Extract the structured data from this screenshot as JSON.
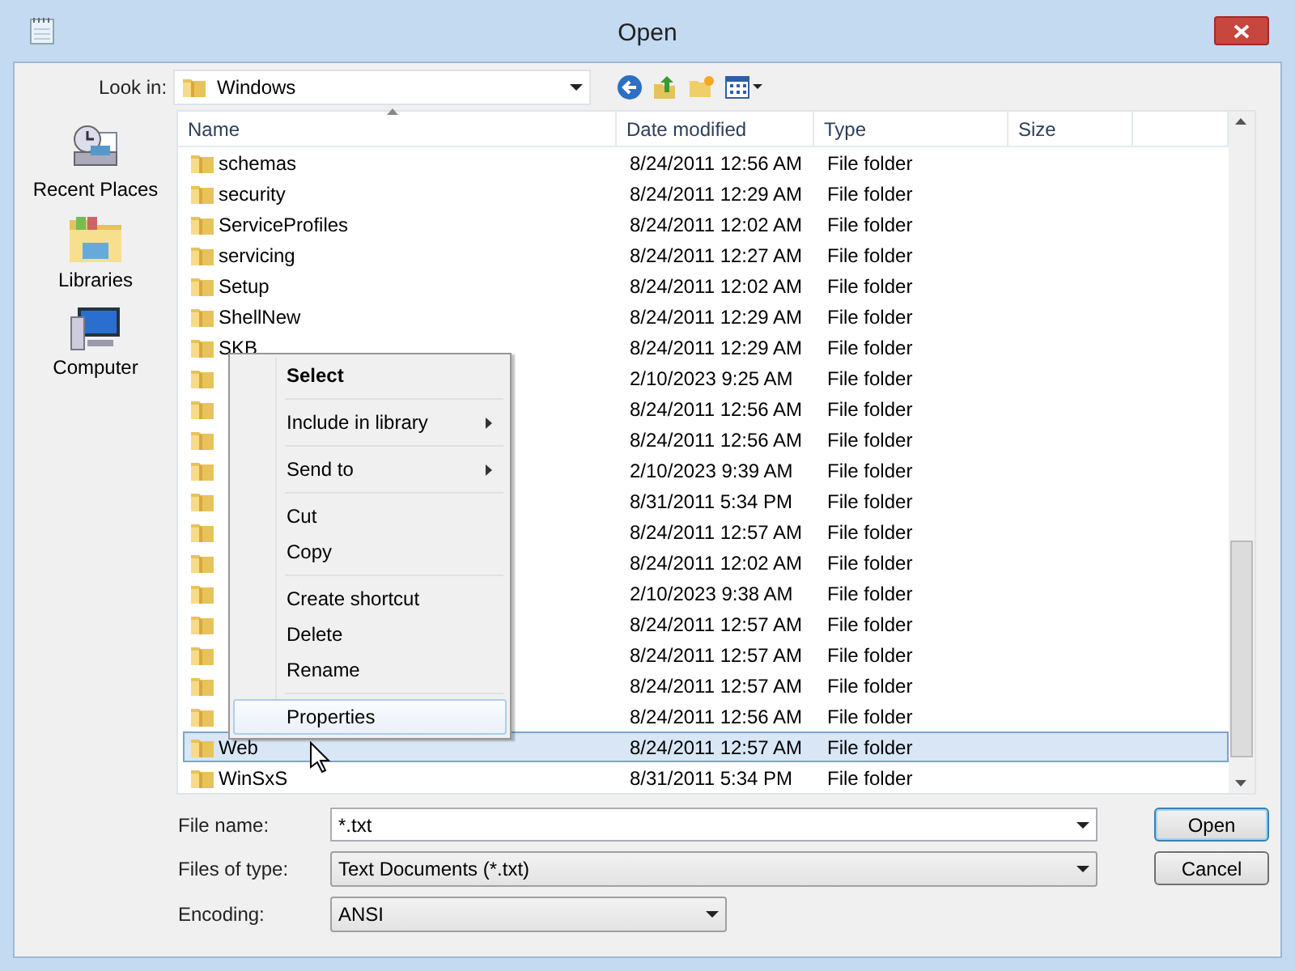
{
  "window": {
    "title": "Open"
  },
  "look_in": {
    "label": "Look in:",
    "value": "Windows"
  },
  "places": [
    {
      "label": "Recent Places",
      "kind": "recent"
    },
    {
      "label": "Libraries",
      "kind": "libraries"
    },
    {
      "label": "Computer",
      "kind": "computer"
    }
  ],
  "table": {
    "columns": [
      "Name",
      "Date modified",
      "Type",
      "Size"
    ],
    "rows": [
      {
        "name": "schemas",
        "date": "8/24/2011 12:56 AM",
        "type": "File folder",
        "selected": false
      },
      {
        "name": "security",
        "date": "8/24/2011 12:29 AM",
        "type": "File folder",
        "selected": false
      },
      {
        "name": "ServiceProfiles",
        "date": "8/24/2011 12:02 AM",
        "type": "File folder",
        "selected": false
      },
      {
        "name": "servicing",
        "date": "8/24/2011 12:27 AM",
        "type": "File folder",
        "selected": false
      },
      {
        "name": "Setup",
        "date": "8/24/2011 12:02 AM",
        "type": "File folder",
        "selected": false
      },
      {
        "name": "ShellNew",
        "date": "8/24/2011 12:29 AM",
        "type": "File folder",
        "selected": false
      },
      {
        "name": "SKB",
        "date": "8/24/2011 12:29 AM",
        "type": "File folder",
        "selected": false
      },
      {
        "date": "2/10/2023 9:25 AM",
        "type": "File folder",
        "selected": false
      },
      {
        "date": "8/24/2011 12:56 AM",
        "type": "File folder",
        "selected": false
      },
      {
        "date": "8/24/2011 12:56 AM",
        "type": "File folder",
        "selected": false
      },
      {
        "date": "2/10/2023 9:39 AM",
        "type": "File folder",
        "selected": false
      },
      {
        "date": "8/31/2011 5:34 PM",
        "type": "File folder",
        "selected": false
      },
      {
        "date": "8/24/2011 12:57 AM",
        "type": "File folder",
        "selected": false
      },
      {
        "date": "8/24/2011 12:02 AM",
        "type": "File folder",
        "selected": false
      },
      {
        "date": "2/10/2023 9:38 AM",
        "type": "File folder",
        "selected": false
      },
      {
        "date": "8/24/2011 12:57 AM",
        "type": "File folder",
        "selected": false
      },
      {
        "date": "8/24/2011 12:57 AM",
        "type": "File folder",
        "selected": false
      },
      {
        "date": "8/24/2011 12:57 AM",
        "type": "File folder",
        "selected": false
      },
      {
        "date": "8/24/2011 12:56 AM",
        "type": "File folder",
        "selected": false
      },
      {
        "name": "Web",
        "date": "8/24/2011 12:57 AM",
        "type": "File folder",
        "selected": true
      },
      {
        "name": "WinSxS",
        "date": "8/31/2011 5:34 PM",
        "type": "File folder",
        "selected": false
      }
    ]
  },
  "context_menu": [
    {
      "kind": "item",
      "label": "Select",
      "bold": true,
      "submenu": false,
      "selected": false
    },
    {
      "kind": "separator"
    },
    {
      "kind": "item",
      "label": "Include in library",
      "bold": false,
      "submenu": true,
      "selected": false
    },
    {
      "kind": "separator"
    },
    {
      "kind": "item",
      "label": "Send to",
      "bold": false,
      "submenu": true,
      "selected": false
    },
    {
      "kind": "separator"
    },
    {
      "kind": "item",
      "label": "Cut",
      "bold": false,
      "submenu": false,
      "selected": false
    },
    {
      "kind": "item",
      "label": "Copy",
      "bold": false,
      "submenu": false,
      "selected": false
    },
    {
      "kind": "separator"
    },
    {
      "kind": "item",
      "label": "Create shortcut",
      "bold": false,
      "submenu": false,
      "selected": false
    },
    {
      "kind": "item",
      "label": "Delete",
      "bold": false,
      "submenu": false,
      "selected": false
    },
    {
      "kind": "item",
      "label": "Rename",
      "bold": false,
      "submenu": false,
      "selected": false
    },
    {
      "kind": "separator"
    },
    {
      "kind": "item",
      "label": "Properties",
      "bold": false,
      "submenu": false,
      "selected": true
    }
  ],
  "fields": [
    {
      "label": "File name:",
      "value": "*.txt",
      "kind": "editable"
    },
    {
      "label": "Files of type:",
      "value": "Text Documents (*.txt)",
      "kind": "dropdown"
    },
    {
      "label": "Encoding:",
      "value": "ANSI",
      "kind": "short-dropdown"
    }
  ],
  "buttons": [
    "Open",
    "Cancel"
  ]
}
